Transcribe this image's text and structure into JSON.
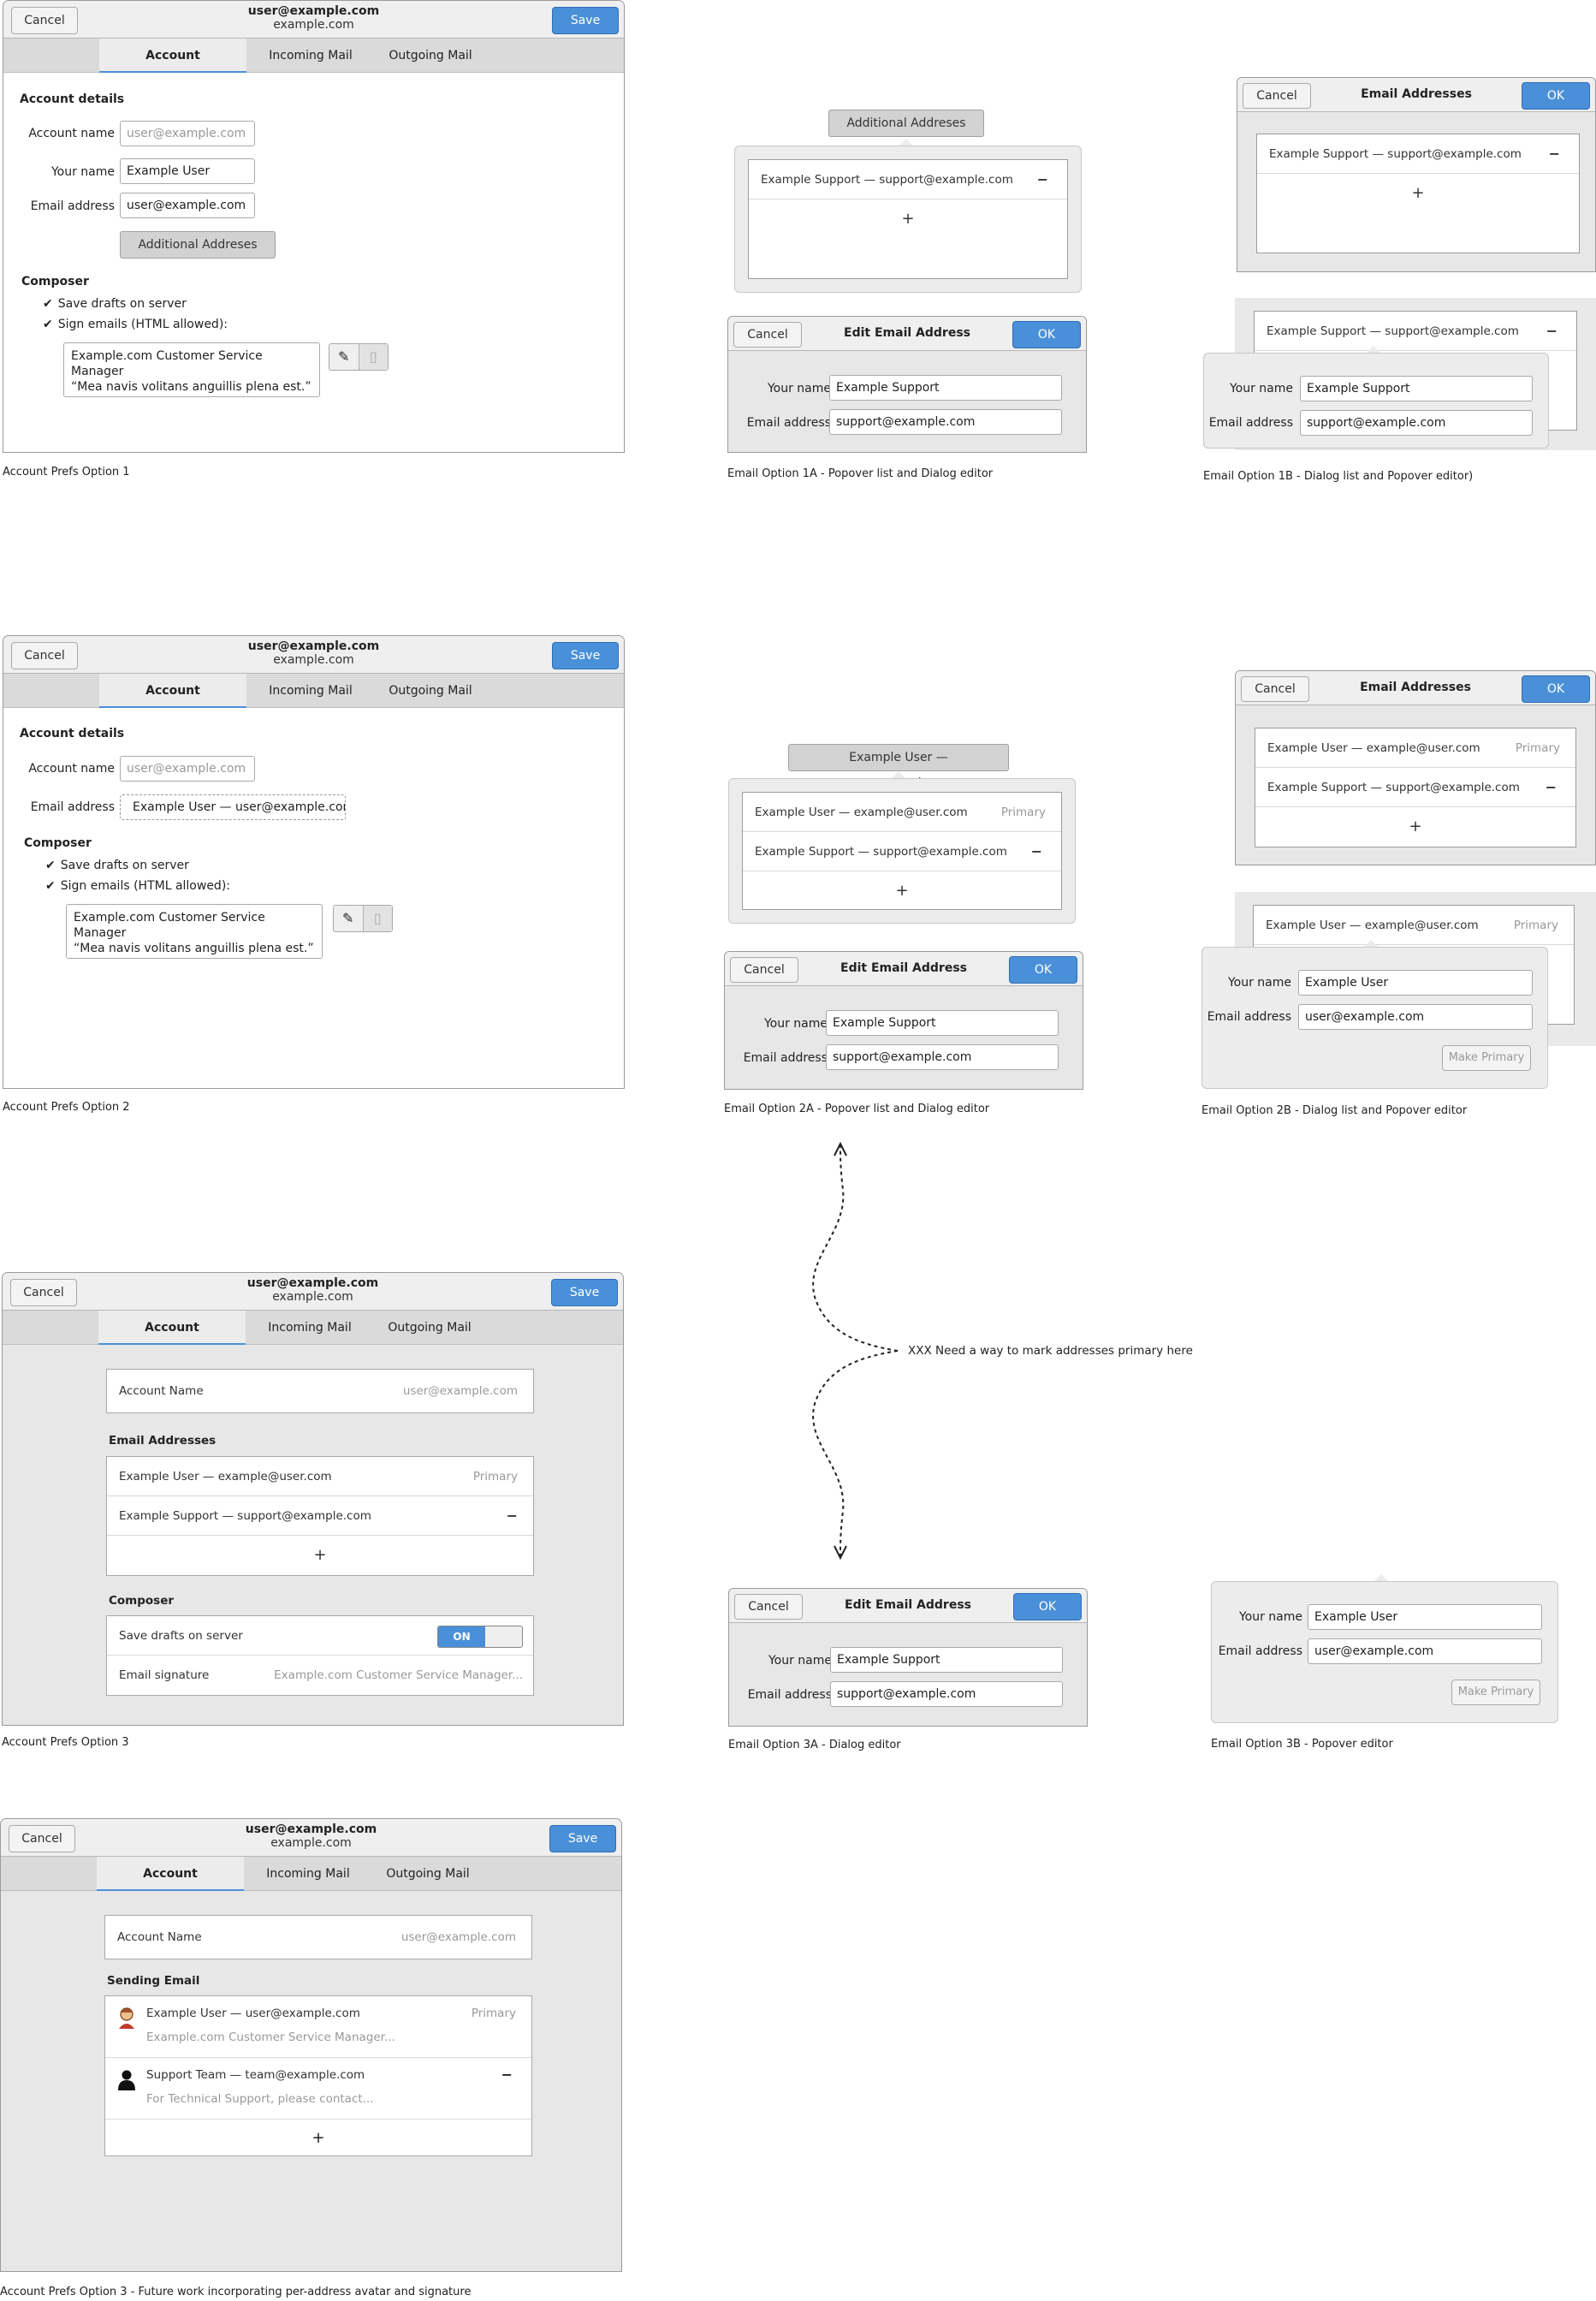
{
  "header": {
    "email": "user@example.com",
    "domain": "example.com",
    "cancel": "Cancel",
    "save": "Save"
  },
  "tabs": [
    "Account",
    "Incoming Mail",
    "Outgoing Mail"
  ],
  "opt1": {
    "section_details": "Account details",
    "account_name_label": "Account name",
    "account_name_placeholder": "user@example.com",
    "your_name_label": "Your name",
    "your_name_value": "Example User",
    "email_label": "Email address",
    "email_value": "user@example.com",
    "additional_button": "Additional Addreses",
    "composer": "Composer",
    "save_drafts": "Save drafts on server",
    "sign_emails": "Sign emails (HTML allowed):",
    "sig_line1": "Example.com Customer Service Manager",
    "sig_line2": "“Mea navis volitans anguillis plena est.”",
    "caption": "Account Prefs Option 1"
  },
  "opt1a": {
    "popover_button": "Additional Addreses",
    "row": "Example Support — support@example.com",
    "dlg_cancel": "Cancel",
    "dlg_title": "Edit Email Address",
    "dlg_ok": "OK",
    "name_label": "Your name",
    "name_value": "Example Support",
    "email_label": "Email address",
    "email_value": "support@example.com",
    "caption": "Email Option 1A - Popover list and Dialog editor"
  },
  "opt1b": {
    "cancel": "Cancel",
    "title": "Email Addresses",
    "ok": "OK",
    "row": "Example Support — support@example.com",
    "name_label": "Your name",
    "name_value": "Example Support",
    "email_label": "Email address",
    "email_value": "support@example.com",
    "caption": "Email Option 1B - Dialog list and Popover editor)"
  },
  "opt2": {
    "section_details": "Account details",
    "account_name_label": "Account name",
    "account_name_placeholder": "user@example.com",
    "email_label": "Email address",
    "email_value": "Example User — user@example.com",
    "composer": "Composer",
    "save_drafts": "Save drafts on server",
    "sign_emails": "Sign emails (HTML allowed):",
    "sig_line1": "Example.com Customer Service Manager",
    "sig_line2": "“Mea navis volitans anguillis plena est.”",
    "caption": "Account Prefs Option 2"
  },
  "opt2a": {
    "popover_button": "Example User — user@example.com",
    "row1": "Example User — example@user.com",
    "row1_tag": "Primary",
    "row2": "Example Support — support@example.com",
    "dlg_cancel": "Cancel",
    "dlg_title": "Edit Email Address",
    "dlg_ok": "OK",
    "name_label": "Your name",
    "name_value": "Example Support",
    "email_label": "Email address",
    "email_value": "support@example.com",
    "caption": "Email Option 2A - Popover list and Dialog editor"
  },
  "opt2b": {
    "cancel": "Cancel",
    "title": "Email Addresses",
    "ok": "OK",
    "row1": "Example User — example@user.com",
    "row1_tag": "Primary",
    "row2": "Example Support — support@example.com",
    "name_label": "Your name",
    "name_value": "Example User",
    "email_label": "Email address",
    "email_value": "user@example.com",
    "make_primary": "Make Primary",
    "caption": "Email Option 2B - Dialog list and Popover editor"
  },
  "note": "XXX Need a way to mark addresses primary here",
  "opt3": {
    "account_name_label": "Account Name",
    "account_name_value": "user@example.com",
    "email_heading": "Email Addresses",
    "row1": "Example User — example@user.com",
    "row1_tag": "Primary",
    "row2": "Example Support — support@example.com",
    "composer": "Composer",
    "save_drafts": "Save drafts on server",
    "toggle_on": "ON",
    "sig_label": "Email signature",
    "sig_value": "Example.com Customer Service Manager...",
    "caption": "Account Prefs Option 3"
  },
  "opt3a": {
    "cancel": "Cancel",
    "title": "Edit Email Address",
    "ok": "OK",
    "name_label": "Your name",
    "name_value": "Example Support",
    "email_label": "Email address",
    "email_value": "support@example.com",
    "caption": "Email Option 3A - Dialog editor"
  },
  "opt3b": {
    "name_label": "Your name",
    "name_value": "Example User",
    "email_label": "Email address",
    "email_value": "user@example.com",
    "make_primary": "Make Primary",
    "caption": "Email Option 3B - Popover editor"
  },
  "opt4": {
    "account_name_label": "Account Name",
    "account_name_value": "user@example.com",
    "sending_heading": "Sending Email",
    "row1": "Example User — user@example.com",
    "row1_tag": "Primary",
    "row1_sub": "Example.com Customer Service Manager...",
    "row2": "Support Team — team@example.com",
    "row2_sub": "For Technical Support, please contact...",
    "caption": "Account Prefs Option 3 - Future work incorporating per-address avatar and signature"
  },
  "colors": {
    "accent": "#4a90d9",
    "window_bg": "#e7e7e7",
    "header_bg": "#efefef"
  }
}
